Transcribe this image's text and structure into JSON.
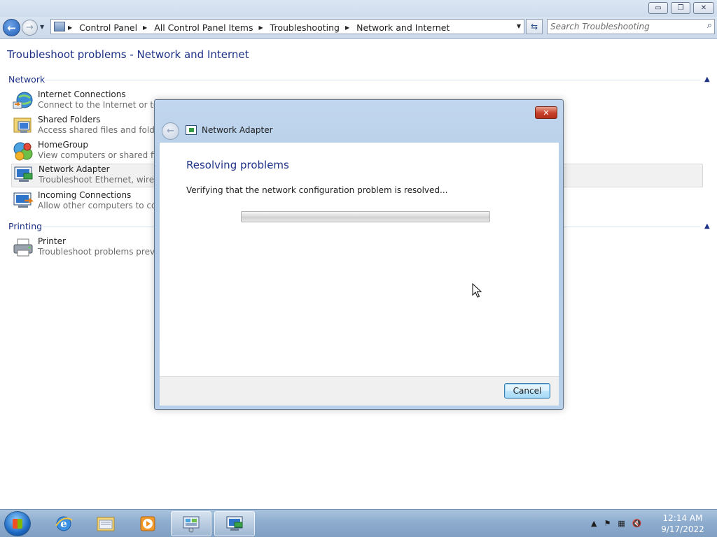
{
  "window": {
    "min_glyph": "▭",
    "max_glyph": "❐",
    "close_glyph": "✕"
  },
  "nav": {
    "back_glyph": "←",
    "forward_glyph": "→",
    "breadcrumbs": [
      "Control Panel",
      "All Control Panel Items",
      "Troubleshooting",
      "Network and Internet"
    ],
    "search_placeholder": "Search Troubleshooting"
  },
  "page": {
    "title": "Troubleshoot problems - Network and Internet"
  },
  "sections": [
    {
      "name": "Network",
      "items": [
        {
          "title": "Internet Connections",
          "desc": "Connect to the Internet or to a",
          "icon": "internet-connections-icon"
        },
        {
          "title": "Shared Folders",
          "desc": "Access shared files and folders c",
          "icon": "shared-folders-icon"
        },
        {
          "title": "HomeGroup",
          "desc": "View computers or shared files i",
          "icon": "homegroup-icon"
        },
        {
          "title": "Network Adapter",
          "desc": "Troubleshoot Ethernet, wireless,",
          "icon": "network-adapter-icon"
        },
        {
          "title": "Incoming Connections",
          "desc": "Allow other computers to comm",
          "icon": "incoming-connections-icon"
        }
      ]
    },
    {
      "name": "Printing",
      "items": [
        {
          "title": "Printer",
          "desc": "Troubleshoot problems prevent",
          "icon": "printer-icon"
        }
      ]
    }
  ],
  "dialog": {
    "title": "Network Adapter",
    "heading": "Resolving problems",
    "status": "Verifying that the network configuration problem is resolved...",
    "progress": 0,
    "cancel_label": "Cancel",
    "close_glyph": "✕"
  },
  "taskbar": {
    "apps": [
      "internet-explorer-icon",
      "windows-explorer-icon",
      "media-player-icon",
      "control-panel-icon",
      "network-adapter-icon"
    ],
    "tray_icons": [
      "show-hidden-icons",
      "action-center-flag-icon",
      "network-warning-icon",
      "volume-muted-icon"
    ],
    "time": "12:14 AM",
    "date": "9/17/2022"
  },
  "colors": {
    "link_blue": "#1e3287",
    "dialog_frame": "#b9d0ea",
    "taskbar": "#8eadcf"
  }
}
